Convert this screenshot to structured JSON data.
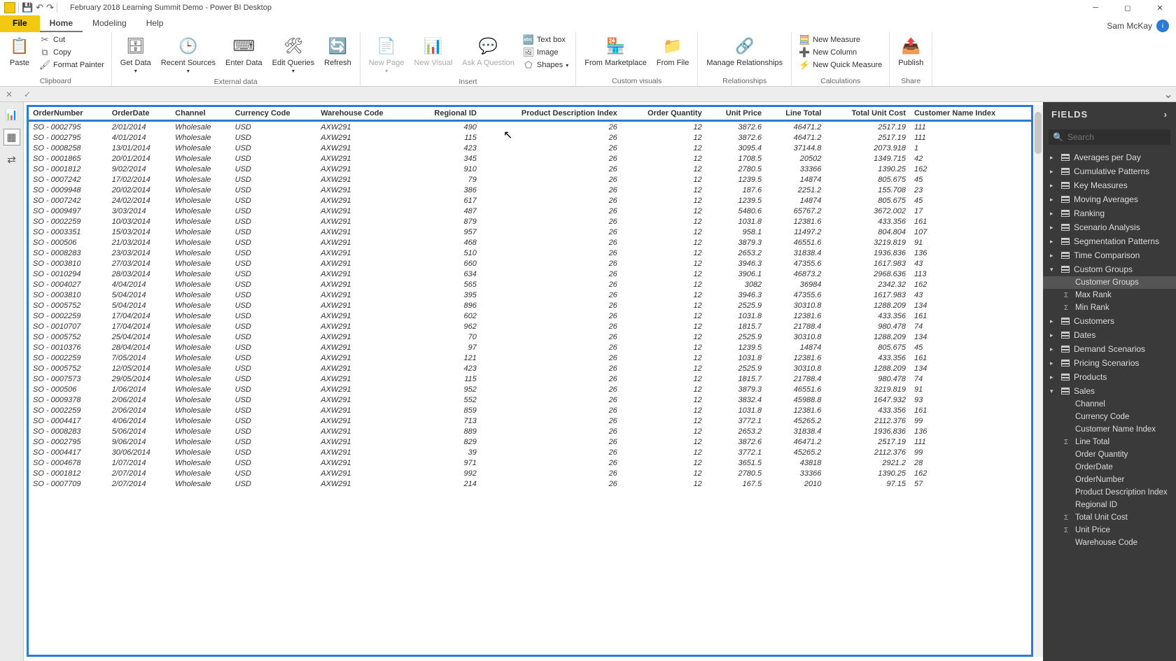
{
  "app": {
    "title": "February 2018 Learning Summit Demo - Power BI Desktop",
    "user": "Sam McKay"
  },
  "tabs": {
    "file": "File",
    "home": "Home",
    "modeling": "Modeling",
    "help": "Help"
  },
  "ribbon": {
    "clipboard": {
      "label": "Clipboard",
      "paste": "Paste",
      "cut": "Cut",
      "copy": "Copy",
      "formatPainter": "Format Painter"
    },
    "external": {
      "label": "External data",
      "getData": "Get\nData",
      "recent": "Recent\nSources",
      "enter": "Enter\nData",
      "edit": "Edit\nQueries",
      "refresh": "Refresh"
    },
    "insert": {
      "label": "Insert",
      "newPage": "New\nPage",
      "newVisual": "New\nVisual",
      "ask": "Ask A\nQuestion",
      "text": "Text box",
      "image": "Image",
      "shapes": "Shapes"
    },
    "custom": {
      "label": "Custom visuals",
      "market": "From\nMarketplace",
      "file": "From\nFile"
    },
    "rel": {
      "label": "Relationships",
      "manage": "Manage\nRelationships"
    },
    "calc": {
      "label": "Calculations",
      "measure": "New Measure",
      "column": "New Column",
      "quick": "New Quick Measure"
    },
    "share": {
      "label": "Share",
      "publish": "Publish"
    }
  },
  "fieldsPane": {
    "title": "FIELDS",
    "searchPlaceholder": "Search",
    "tables": [
      {
        "name": "Averages per Day",
        "open": false
      },
      {
        "name": "Cumulative Patterns",
        "open": false
      },
      {
        "name": "Key Measures",
        "open": false
      },
      {
        "name": "Moving Averages",
        "open": false
      },
      {
        "name": "Ranking",
        "open": false
      },
      {
        "name": "Scenario Analysis",
        "open": false
      },
      {
        "name": "Segmentation Patterns",
        "open": false
      },
      {
        "name": "Time Comparison",
        "open": false
      },
      {
        "name": "Custom Groups",
        "open": true,
        "fields": [
          {
            "n": "Customer Groups",
            "sel": true
          },
          {
            "n": "Max Rank",
            "ico": "Σ"
          },
          {
            "n": "Min Rank",
            "ico": "Σ"
          }
        ]
      },
      {
        "name": "Customers",
        "open": false
      },
      {
        "name": "Dates",
        "open": false
      },
      {
        "name": "Demand Scenarios",
        "open": false
      },
      {
        "name": "Pricing Scenarios",
        "open": false
      },
      {
        "name": "Products",
        "open": false
      },
      {
        "name": "Sales",
        "open": true,
        "fields": [
          {
            "n": "Channel"
          },
          {
            "n": "Currency Code"
          },
          {
            "n": "Customer Name Index"
          },
          {
            "n": "Line Total",
            "ico": "Σ"
          },
          {
            "n": "Order Quantity"
          },
          {
            "n": "OrderDate"
          },
          {
            "n": "OrderNumber"
          },
          {
            "n": "Product Description Index"
          },
          {
            "n": "Regional ID"
          },
          {
            "n": "Total Unit Cost",
            "ico": "Σ"
          },
          {
            "n": "Unit Price",
            "ico": "Σ"
          },
          {
            "n": "Warehouse Code"
          }
        ]
      }
    ]
  },
  "table": {
    "headers": [
      "OrderNumber",
      "OrderDate",
      "Channel",
      "Currency Code",
      "Warehouse Code",
      "Regional ID",
      "Product Description Index",
      "Order Quantity",
      "Unit Price",
      "Line Total",
      "Total Unit Cost",
      "Customer Name Index"
    ],
    "rows": [
      [
        "SO - 0002795",
        "2/01/2014",
        "Wholesale",
        "USD",
        "AXW291",
        "490",
        "26",
        "12",
        "3872.6",
        "46471.2",
        "2517.19",
        "111"
      ],
      [
        "SO - 0002795",
        "4/01/2014",
        "Wholesale",
        "USD",
        "AXW291",
        "115",
        "26",
        "12",
        "3872.6",
        "46471.2",
        "2517.19",
        "111"
      ],
      [
        "SO - 0008258",
        "13/01/2014",
        "Wholesale",
        "USD",
        "AXW291",
        "423",
        "26",
        "12",
        "3095.4",
        "37144.8",
        "2073.918",
        "1"
      ],
      [
        "SO - 0001865",
        "20/01/2014",
        "Wholesale",
        "USD",
        "AXW291",
        "345",
        "26",
        "12",
        "1708.5",
        "20502",
        "1349.715",
        "42"
      ],
      [
        "SO - 0001812",
        "9/02/2014",
        "Wholesale",
        "USD",
        "AXW291",
        "910",
        "26",
        "12",
        "2780.5",
        "33366",
        "1390.25",
        "162"
      ],
      [
        "SO - 0007242",
        "17/02/2014",
        "Wholesale",
        "USD",
        "AXW291",
        "79",
        "26",
        "12",
        "1239.5",
        "14874",
        "805.675",
        "45"
      ],
      [
        "SO - 0009948",
        "20/02/2014",
        "Wholesale",
        "USD",
        "AXW291",
        "386",
        "26",
        "12",
        "187.6",
        "2251.2",
        "155.708",
        "23"
      ],
      [
        "SO - 0007242",
        "24/02/2014",
        "Wholesale",
        "USD",
        "AXW291",
        "617",
        "26",
        "12",
        "1239.5",
        "14874",
        "805.675",
        "45"
      ],
      [
        "SO - 0009497",
        "3/03/2014",
        "Wholesale",
        "USD",
        "AXW291",
        "487",
        "26",
        "12",
        "5480.6",
        "65767.2",
        "3672.002",
        "17"
      ],
      [
        "SO - 0002259",
        "10/03/2014",
        "Wholesale",
        "USD",
        "AXW291",
        "879",
        "26",
        "12",
        "1031.8",
        "12381.6",
        "433.356",
        "161"
      ],
      [
        "SO - 0003351",
        "15/03/2014",
        "Wholesale",
        "USD",
        "AXW291",
        "957",
        "26",
        "12",
        "958.1",
        "11497.2",
        "804.804",
        "107"
      ],
      [
        "SO - 000506",
        "21/03/2014",
        "Wholesale",
        "USD",
        "AXW291",
        "468",
        "26",
        "12",
        "3879.3",
        "46551.6",
        "3219.819",
        "91"
      ],
      [
        "SO - 0008283",
        "23/03/2014",
        "Wholesale",
        "USD",
        "AXW291",
        "510",
        "26",
        "12",
        "2653.2",
        "31838.4",
        "1936.836",
        "136"
      ],
      [
        "SO - 0003810",
        "27/03/2014",
        "Wholesale",
        "USD",
        "AXW291",
        "660",
        "26",
        "12",
        "3946.3",
        "47355.6",
        "1617.983",
        "43"
      ],
      [
        "SO - 0010294",
        "28/03/2014",
        "Wholesale",
        "USD",
        "AXW291",
        "634",
        "26",
        "12",
        "3906.1",
        "46873.2",
        "2968.636",
        "113"
      ],
      [
        "SO - 0004027",
        "4/04/2014",
        "Wholesale",
        "USD",
        "AXW291",
        "565",
        "26",
        "12",
        "3082",
        "36984",
        "2342.32",
        "162"
      ],
      [
        "SO - 0003810",
        "5/04/2014",
        "Wholesale",
        "USD",
        "AXW291",
        "395",
        "26",
        "12",
        "3946.3",
        "47355.6",
        "1617.983",
        "43"
      ],
      [
        "SO - 0005752",
        "5/04/2014",
        "Wholesale",
        "USD",
        "AXW291",
        "896",
        "26",
        "12",
        "2525.9",
        "30310.8",
        "1288.209",
        "134"
      ],
      [
        "SO - 0002259",
        "17/04/2014",
        "Wholesale",
        "USD",
        "AXW291",
        "602",
        "26",
        "12",
        "1031.8",
        "12381.6",
        "433.356",
        "161"
      ],
      [
        "SO - 0010707",
        "17/04/2014",
        "Wholesale",
        "USD",
        "AXW291",
        "962",
        "26",
        "12",
        "1815.7",
        "21788.4",
        "980.478",
        "74"
      ],
      [
        "SO - 0005752",
        "25/04/2014",
        "Wholesale",
        "USD",
        "AXW291",
        "70",
        "26",
        "12",
        "2525.9",
        "30310.8",
        "1288.209",
        "134"
      ],
      [
        "SO - 0010376",
        "28/04/2014",
        "Wholesale",
        "USD",
        "AXW291",
        "97",
        "26",
        "12",
        "1239.5",
        "14874",
        "805.675",
        "45"
      ],
      [
        "SO - 0002259",
        "7/05/2014",
        "Wholesale",
        "USD",
        "AXW291",
        "121",
        "26",
        "12",
        "1031.8",
        "12381.6",
        "433.356",
        "161"
      ],
      [
        "SO - 0005752",
        "12/05/2014",
        "Wholesale",
        "USD",
        "AXW291",
        "423",
        "26",
        "12",
        "2525.9",
        "30310.8",
        "1288.209",
        "134"
      ],
      [
        "SO - 0007573",
        "29/05/2014",
        "Wholesale",
        "USD",
        "AXW291",
        "115",
        "26",
        "12",
        "1815.7",
        "21788.4",
        "980.478",
        "74"
      ],
      [
        "SO - 000506",
        "1/06/2014",
        "Wholesale",
        "USD",
        "AXW291",
        "952",
        "26",
        "12",
        "3879.3",
        "46551.6",
        "3219.819",
        "91"
      ],
      [
        "SO - 0009378",
        "2/06/2014",
        "Wholesale",
        "USD",
        "AXW291",
        "552",
        "26",
        "12",
        "3832.4",
        "45988.8",
        "1647.932",
        "93"
      ],
      [
        "SO - 0002259",
        "2/06/2014",
        "Wholesale",
        "USD",
        "AXW291",
        "859",
        "26",
        "12",
        "1031.8",
        "12381.6",
        "433.356",
        "161"
      ],
      [
        "SO - 0004417",
        "4/06/2014",
        "Wholesale",
        "USD",
        "AXW291",
        "713",
        "26",
        "12",
        "3772.1",
        "45265.2",
        "2112.376",
        "99"
      ],
      [
        "SO - 0008283",
        "5/06/2014",
        "Wholesale",
        "USD",
        "AXW291",
        "889",
        "26",
        "12",
        "2653.2",
        "31838.4",
        "1936.836",
        "136"
      ],
      [
        "SO - 0002795",
        "9/06/2014",
        "Wholesale",
        "USD",
        "AXW291",
        "829",
        "26",
        "12",
        "3872.6",
        "46471.2",
        "2517.19",
        "111"
      ],
      [
        "SO - 0004417",
        "30/06/2014",
        "Wholesale",
        "USD",
        "AXW291",
        "39",
        "26",
        "12",
        "3772.1",
        "45265.2",
        "2112.376",
        "99"
      ],
      [
        "SO - 0004678",
        "1/07/2014",
        "Wholesale",
        "USD",
        "AXW291",
        "971",
        "26",
        "12",
        "3651.5",
        "43818",
        "2921.2",
        "28"
      ],
      [
        "SO - 0001812",
        "2/07/2014",
        "Wholesale",
        "USD",
        "AXW291",
        "992",
        "26",
        "12",
        "2780.5",
        "33366",
        "1390.25",
        "162"
      ],
      [
        "SO - 0007709",
        "2/07/2014",
        "Wholesale",
        "USD",
        "AXW291",
        "214",
        "26",
        "12",
        "167.5",
        "2010",
        "97.15",
        "57"
      ]
    ]
  }
}
